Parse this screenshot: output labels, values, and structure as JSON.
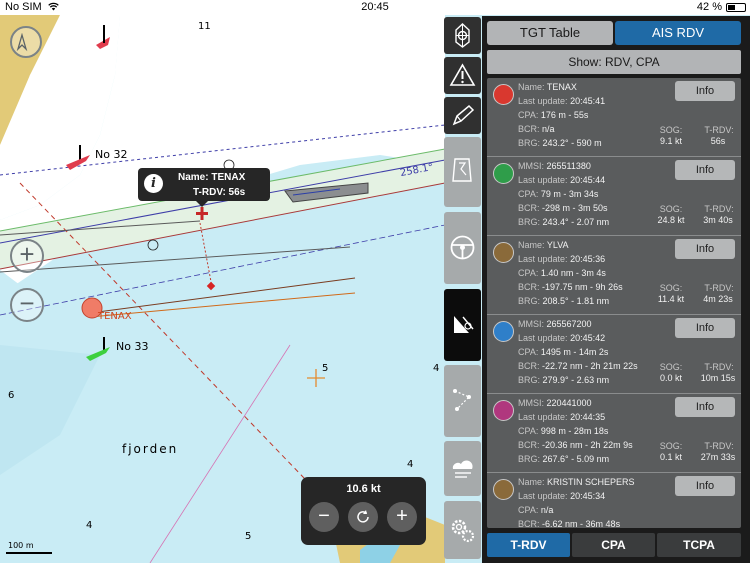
{
  "status_bar": {
    "carrier": "No SIM",
    "wifi_icon": "wifi-icon",
    "time": "20:45",
    "battery": "42 %"
  },
  "map": {
    "labels": {
      "no32": "No 32",
      "no33": "No 33",
      "fjorden": "fjorden",
      "tenax": "TENAX",
      "bearing": "258.1°",
      "depth_11": "11",
      "depth_6": "6",
      "depth_5a": "5",
      "depth_4a": "4",
      "depth_4b": "4",
      "depth_4c": "4",
      "depth_5b": "5",
      "scale": "100 m"
    }
  },
  "callout": {
    "name_line": "Name: TENAX",
    "trdv_line": "T-RDV: 56s"
  },
  "speed_panel": {
    "speed": "10.6 kt",
    "minus": "−",
    "plus": "+"
  },
  "zoom": {
    "in": "+",
    "out": "−"
  },
  "toolbar": [
    "compass-icon",
    "warning-icon",
    "pencil-icon",
    "route-icon",
    "steering-wheel-icon",
    "ais-icon",
    "waypoints-icon",
    "weather-icon",
    "settings-icon"
  ],
  "panel": {
    "tabs": {
      "tgt_table": "TGT Table",
      "ais_rdv": "AIS RDV"
    },
    "show_filter": "Show: RDV, CPA",
    "info_label": "Info",
    "labels": {
      "sog": "SOG:",
      "trdv": "T-RDV:"
    },
    "targets": [
      {
        "id_label": "Name:",
        "id": "TENAX",
        "last_update": "20:45:41",
        "cpa": "176 m - 55s",
        "bcr": "n/a",
        "brg": "243.2° - 590 m",
        "sog": "9.1 kt",
        "trdv": "56s",
        "color": "#d9382f"
      },
      {
        "id_label": "MMSI:",
        "id": "265511380",
        "last_update": "20:45:44",
        "cpa": "79 m - 3m 34s",
        "bcr": "-298 m - 3m 50s",
        "brg": "243.4° - 2.07 nm",
        "sog": "24.8 kt",
        "trdv": "3m 40s",
        "color": "#2f9d4a"
      },
      {
        "id_label": "Name:",
        "id": "YLVA",
        "last_update": "20:45:36",
        "cpa": "1.40 nm - 3m 4s",
        "bcr": "-197.75 nm - 9h 26s",
        "brg": "208.5° - 1.81 nm",
        "sog": "11.4 kt",
        "trdv": "4m 23s",
        "color": "#8a6a3a"
      },
      {
        "id_label": "MMSI:",
        "id": "265567200",
        "last_update": "20:45:42",
        "cpa": "1495 m - 14m 2s",
        "bcr": "-22.72 nm - 2h 21m 22s",
        "brg": "279.9° - 2.63 nm",
        "sog": "0.0 kt",
        "trdv": "10m 15s",
        "color": "#2f7fc9"
      },
      {
        "id_label": "MMSI:",
        "id": "220441000",
        "last_update": "20:44:35",
        "cpa": "998 m - 28m 18s",
        "bcr": "-20.36 nm - 2h 22m 9s",
        "brg": "267.6° - 5.09 nm",
        "sog": "0.1 kt",
        "trdv": "27m 33s",
        "color": "#b0377e"
      },
      {
        "id_label": "Name:",
        "id": "KRISTIN SCHEPERS",
        "last_update": "20:45:34",
        "cpa": "n/a",
        "bcr": "-6.62 nm - 36m 48s",
        "brg": "",
        "sog": "",
        "trdv": "",
        "color": "#8a6a3a"
      }
    ],
    "row_labels": {
      "last_update": "Last update:",
      "cpa": "CPA:",
      "bcr": "BCR:",
      "brg": "BRG:"
    },
    "bottom_tabs": {
      "trdv": "T-RDV",
      "cpa": "CPA",
      "tcpa": "TCPA"
    },
    "accent": "#1f6aa6"
  }
}
